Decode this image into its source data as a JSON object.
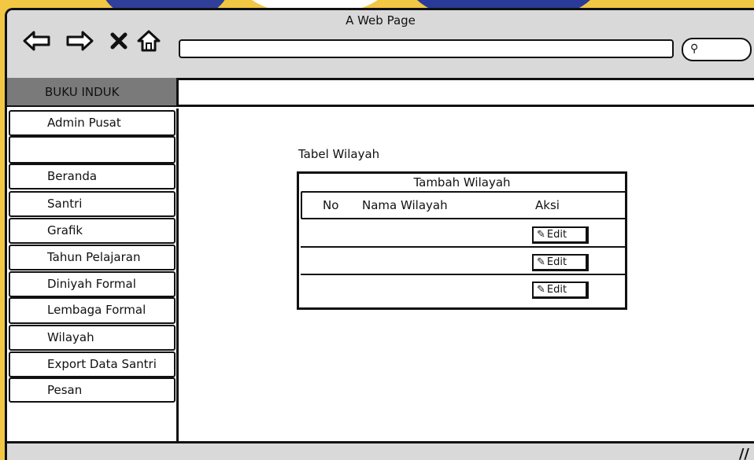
{
  "window": {
    "title": "A Web Page"
  },
  "browser": {
    "address_value": "",
    "icons": [
      "back-arrow-icon",
      "forward-arrow-icon",
      "close-x-icon",
      "home-icon",
      "search-icon"
    ]
  },
  "sidebar": {
    "header": "BUKU INDUK",
    "items": [
      {
        "label": "Admin Pusat"
      },
      {
        "label": ""
      },
      {
        "label": "Beranda"
      },
      {
        "label": "Santri"
      },
      {
        "label": "Grafik"
      },
      {
        "label": "Tahun Pelajaran"
      },
      {
        "label": "Diniyah Formal"
      },
      {
        "label": "Lembaga Formal"
      },
      {
        "label": "Wilayah"
      },
      {
        "label": "Export Data Santri"
      },
      {
        "label": "Pesan"
      }
    ]
  },
  "main": {
    "title": "Tabel Wilayah",
    "table": {
      "caption": "Tambah Wilayah",
      "columns": [
        "No",
        "Nama Wilayah",
        "Aksi"
      ],
      "rows": [
        {
          "no": "",
          "nama": "",
          "action": "Edit"
        },
        {
          "no": "",
          "nama": "",
          "action": "Edit"
        },
        {
          "no": "",
          "nama": "",
          "action": "Edit"
        }
      ]
    }
  },
  "colors": {
    "background": "#f2c744",
    "chrome": "#d9d9d9",
    "sidebar_header": "#7a7a7a",
    "border": "#111111"
  }
}
